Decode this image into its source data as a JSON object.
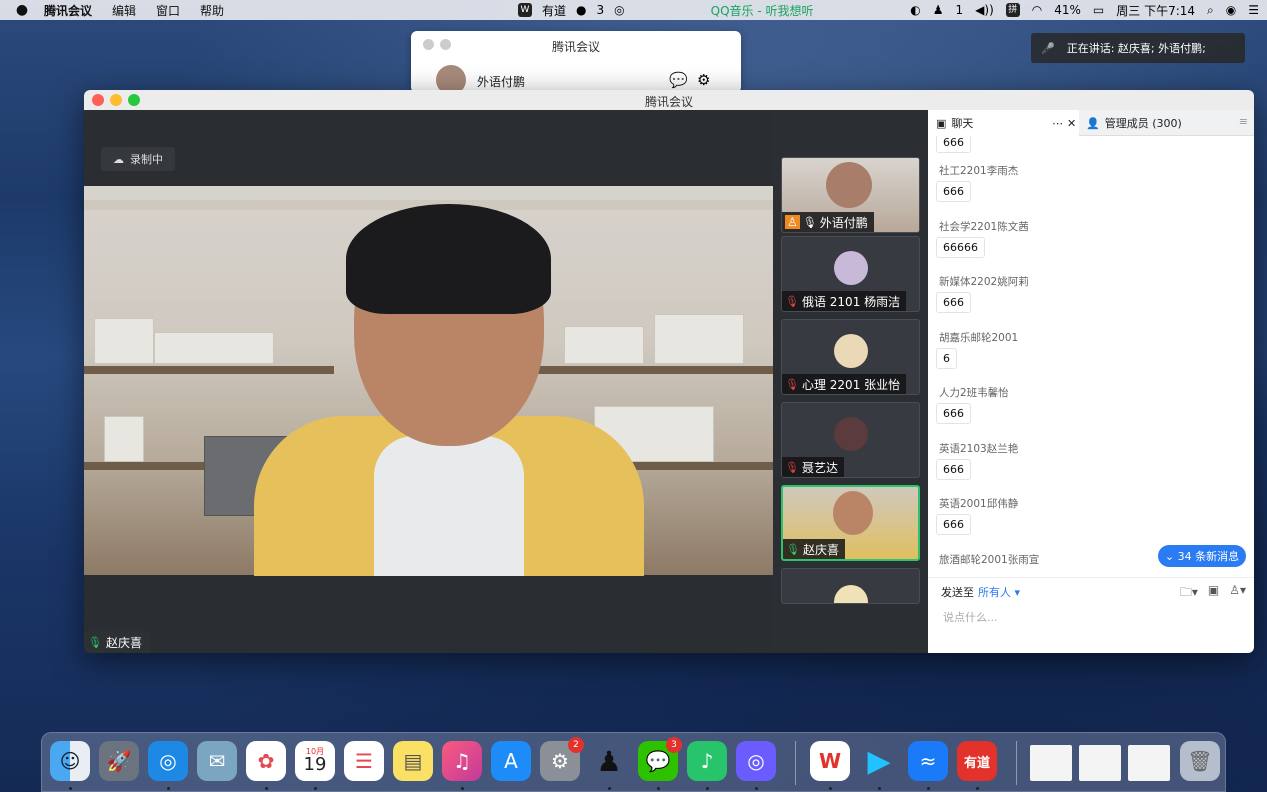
{
  "menubar": {
    "apple": "",
    "app": "腾讯会议",
    "items": [
      "编辑",
      "窗口",
      "帮助"
    ],
    "center": {
      "youdao": "有道",
      "wechat_count": "3",
      "qq_music": "QQ音乐 - 听我想听"
    },
    "right": {
      "qq_count": "1",
      "battery": "41%",
      "datetime": "周三 下午7:14"
    }
  },
  "mini_window": {
    "title": "腾讯会议",
    "user": "外语付鹏"
  },
  "notification": {
    "text": "正在讲话: 赵庆喜; 外语付鹏;"
  },
  "window": {
    "title": "腾讯会议"
  },
  "main_video": {
    "recording": "录制中",
    "speaker": "赵庆喜"
  },
  "tiles": [
    {
      "name": "外语付鹏",
      "muted": false
    },
    {
      "name": "俄语 2101 杨雨洁",
      "muted": true
    },
    {
      "name": "心理 2201 张业怡",
      "muted": true
    },
    {
      "name": "聂艺达",
      "muted": true
    },
    {
      "name": "赵庆喜",
      "muted": false
    }
  ],
  "chat": {
    "tab_chat": "聊天",
    "tab_members": "管理成员 (300)",
    "messages": [
      {
        "who": "",
        "text": "666"
      },
      {
        "who": "社工2201李雨杰",
        "text": "666"
      },
      {
        "who": "社会学2201陈文茜",
        "text": "66666"
      },
      {
        "who": "新媒体2202姚阿莉",
        "text": "666"
      },
      {
        "who": "胡嘉乐邮轮2001",
        "text": "6"
      },
      {
        "who": "人力2班韦馨怡",
        "text": "666"
      },
      {
        "who": "英语2103赵兰艳",
        "text": "666"
      },
      {
        "who": "英语2001邱伟静",
        "text": "666"
      },
      {
        "who": "旅酒邮轮2001张雨宣",
        "text": ""
      }
    ],
    "new_messages": "34 条新消息",
    "send_to": "发送至",
    "send_target": "所有人",
    "placeholder": "说点什么..."
  },
  "dock": {
    "calendar_month": "10月",
    "calendar_day": "19",
    "settings_badge": "2",
    "wechat_badge": "3",
    "youdao": "有道"
  }
}
